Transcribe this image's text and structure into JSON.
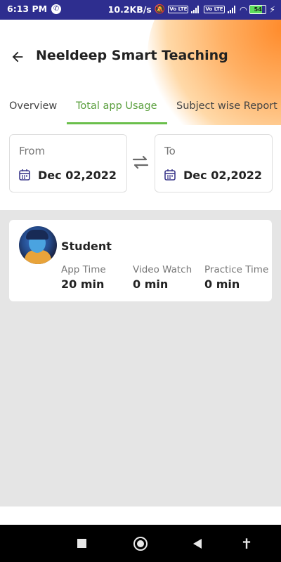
{
  "status_bar": {
    "time": "6:13 PM",
    "speed": "10.2KB/s",
    "battery": "54",
    "volte1": "Vo LTE",
    "volte2": "Vo LTE"
  },
  "header": {
    "title": "Neeldeep Smart Teaching"
  },
  "tabs": [
    {
      "label": "Overview"
    },
    {
      "label": "Total app Usage"
    },
    {
      "label": "Subject wise Report"
    }
  ],
  "date_range": {
    "from_label": "From",
    "from_value": "Dec 02,2022",
    "to_label": "To",
    "to_value": "Dec 02,2022"
  },
  "student_card": {
    "name": "Student",
    "stats": [
      {
        "label": "App Time",
        "value": "20 min"
      },
      {
        "label": "Video Watch",
        "value": "0 min"
      },
      {
        "label": "Practice Time",
        "value": "0 min"
      }
    ]
  },
  "colors": {
    "status_bar": "#2e2e8f",
    "active_tab": "#5a9f3d",
    "accent_orange": "#ff8a2a"
  }
}
